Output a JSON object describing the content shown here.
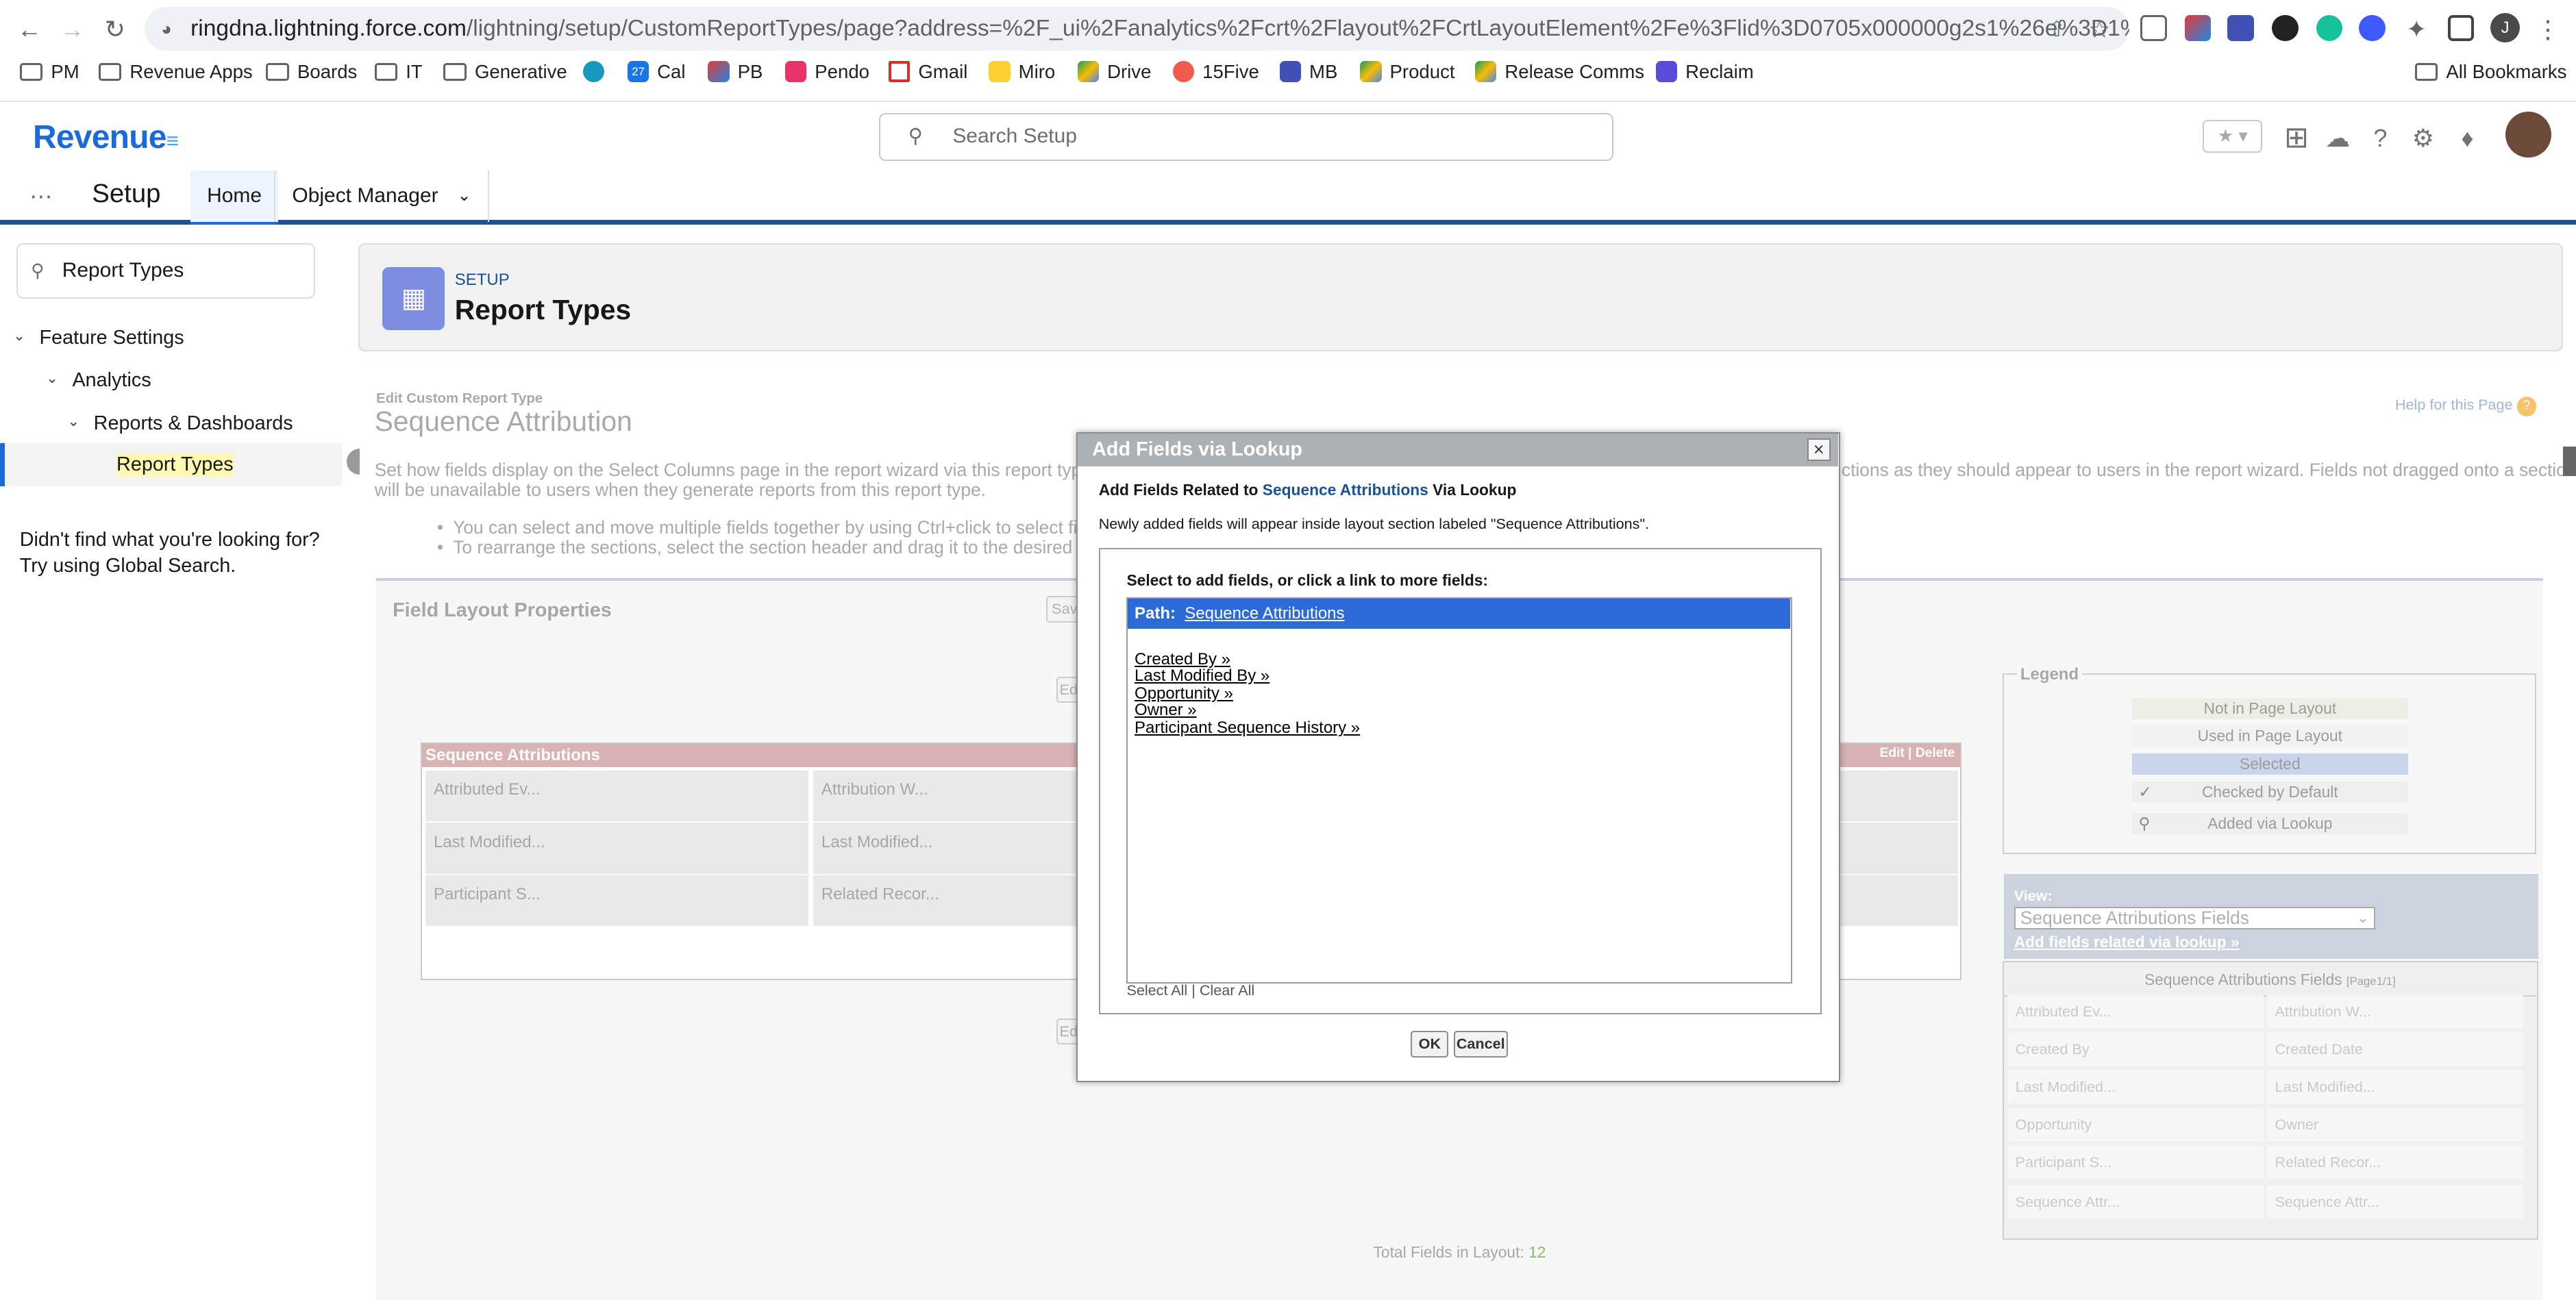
{
  "browser": {
    "url_host": "ringdna.lightning.force.com",
    "url_path": "/lightning/setup/CustomReportTypes/page?address=%2F_ui%2Fanalytics%2Fcrt%2Flayout%2FCrtLayoutElement%2Fe%3Flid%3D0705x000000g2s1%26e%3D1%26retURL...",
    "avatar_letter": "J",
    "all_bookmarks": "All Bookmarks",
    "bookmarks": [
      "PM",
      "Revenue Apps",
      "Boards",
      "IT",
      "Generative",
      "",
      "Cal",
      "PB",
      "Pendo",
      "Gmail",
      "Miro",
      "Drive",
      "15Five",
      "MB",
      "Product",
      "Release Comms",
      "Reclaim"
    ],
    "cal_icon_text": "27"
  },
  "header": {
    "logo": "Revenue",
    "search_placeholder": "Search Setup"
  },
  "appbar": {
    "app_name": "Setup",
    "tabs": [
      "Home",
      "Object Manager"
    ]
  },
  "leftnav": {
    "quickfind": "Report Types",
    "tree": [
      "Feature Settings",
      "Analytics",
      "Reports & Dashboards",
      "Report Types"
    ],
    "help_line1": "Didn't find what you're looking for?",
    "help_line2": "Try using Global Search."
  },
  "pageheader": {
    "eyebrow": "SETUP",
    "title": "Report Types"
  },
  "content": {
    "edit_label": "Edit Custom Report Type",
    "title": "Sequence Attribution",
    "help_link": "Help for this Page",
    "desc_left": "Set how fields display on the Select Columns page in the report wizard via this report type by",
    "desc_right": "ctions as they should appear to users in the report wizard. Fields not dragged onto a section",
    "desc_line2": "will be unavailable to users when they generate reports from this report type.",
    "bullet1": "You can select and move multiple fields together by using Ctrl+click to select fields",
    "bullet2": "To rearrange the sections, select the section header and drag it to the desired locat",
    "field_layout_title": "Field Layout Properties",
    "save_btn": "Sav",
    "ed_btn": "Ed",
    "section_title": "Sequence Attributions",
    "section_actions": "Edit | Delete",
    "section_cells": [
      "Attributed Ev...",
      "Attribution W...",
      "Last Modified...",
      "Last Modified...",
      "Participant S...",
      "Related Recor..."
    ],
    "total_fields_label": "Total Fields in Layout:",
    "total_fields_value": "12"
  },
  "legend": {
    "title": "Legend",
    "items": [
      "Not in Page Layout",
      "Used in Page Layout",
      "Selected",
      "Checked by Default",
      "Added via Lookup"
    ]
  },
  "view": {
    "label": "View:",
    "selected": "Sequence Attributions Fields",
    "lookup_link": "Add fields related via lookup »",
    "fields_title": "Sequence Attributions Fields",
    "fields_page": "[Page1/1]",
    "fields": [
      "Attributed Ev...",
      "Attribution W...",
      "Created By",
      "Created Date",
      "Last Modified...",
      "Last Modified...",
      "Opportunity",
      "Owner",
      "Participant S...",
      "Related Recor...",
      "Sequence Attr...",
      "Sequence Attr..."
    ]
  },
  "dialog": {
    "title": "Add Fields via Lookup",
    "close": "×",
    "heading_prefix": "Add Fields Related to",
    "heading_link": "Sequence Attributions",
    "heading_suffix": "Via Lookup",
    "note": "Newly added fields will appear inside layout section labeled \"Sequence Attributions\".",
    "instructions": "Select to add fields, or click a link to more fields:",
    "path_label": "Path:",
    "path_link": "Sequence Attributions",
    "links": [
      "Created By »",
      "Last Modified By »",
      "Opportunity »",
      "Owner »",
      "Participant Sequence History »"
    ],
    "select_all": "Select All",
    "sep": "|",
    "clear_all": "Clear All",
    "ok": "OK",
    "cancel": "Cancel"
  },
  "colors": {
    "brand": "#1b6ad9",
    "selected_path": "#2c6ad6",
    "section_header": "#d9b3b3"
  }
}
